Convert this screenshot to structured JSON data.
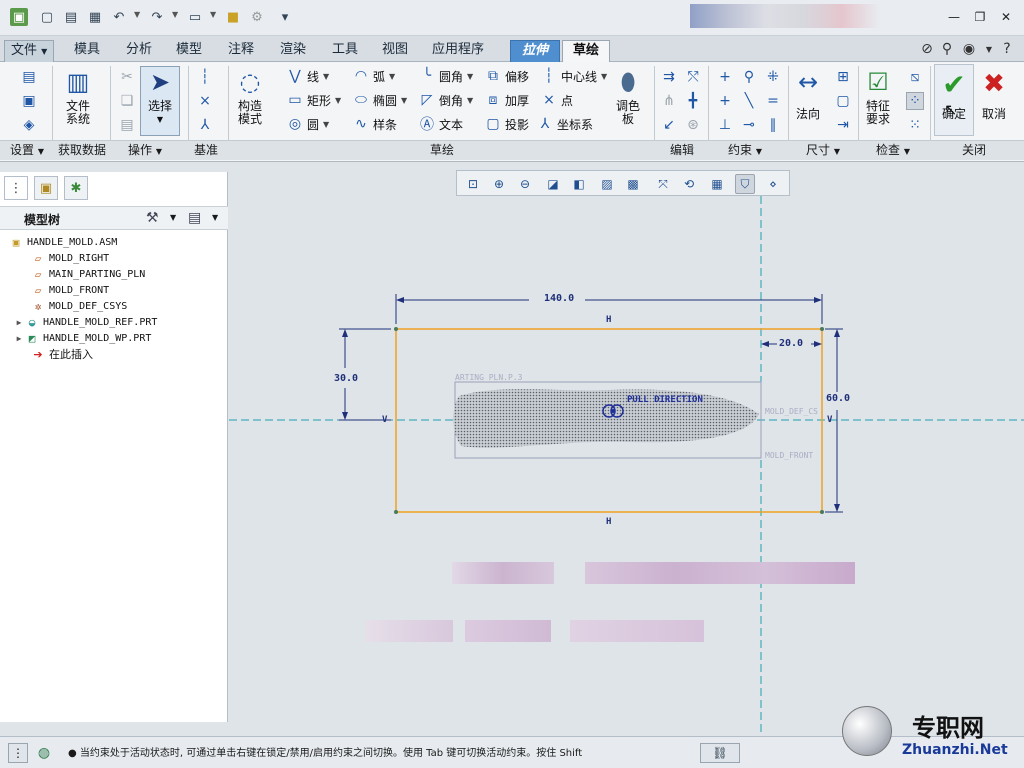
{
  "colors": {
    "ribbon_bg": "#f3f5f7",
    "canvas_bg": "#dfe4e8",
    "sketch_rect": "#f0a020",
    "dimension": "#1f2f7a",
    "centerline": "#1fa0b0",
    "confirm_green": "#2a9a2a",
    "cancel_red": "#cc2222",
    "active_tab": "#4f8fcf"
  },
  "quick_access": {
    "icons": [
      "app-logo-icon",
      "new-file-icon",
      "open-file-icon",
      "save-icon",
      "undo-icon",
      "redo-icon",
      "window-icon",
      "folder-icon",
      "regenerate-icon",
      "customize-icon"
    ]
  },
  "menu_tabs": [
    {
      "label": "文件"
    },
    {
      "label": "模具"
    },
    {
      "label": "分析"
    },
    {
      "label": "模型"
    },
    {
      "label": "注释"
    },
    {
      "label": "渲染"
    },
    {
      "label": "工具"
    },
    {
      "label": "视图"
    },
    {
      "label": "应用程序"
    },
    {
      "label": "拉伸"
    },
    {
      "label": "草绘"
    }
  ],
  "ribbon": {
    "groups": {
      "settings": "设置",
      "get_data": "获取数据",
      "operations": "操作",
      "datum": "基准",
      "sketch": "草绘",
      "edit": "编辑",
      "constrain": "约束",
      "dimension": "尺寸",
      "inspect": "检查",
      "close": "关闭"
    },
    "file_system": [
      "文件",
      "系统"
    ],
    "select": "选择",
    "construction_mode": [
      "构造",
      "模式"
    ],
    "sketch_tools": {
      "line": "线",
      "arc": "弧",
      "fillet": "圆角",
      "offset": "偏移",
      "centerline": "中心线",
      "rectangle": "矩形",
      "ellipse": "椭圆",
      "chamfer": "倒角",
      "thicken": "加厚",
      "point": "点",
      "circle": "圆",
      "spline": "样条",
      "text": "文本",
      "project": "投影",
      "csys": "坐标系"
    },
    "palette": [
      "调色",
      "板"
    ],
    "normal": "法向",
    "feature_req": [
      "特征",
      "要求"
    ],
    "confirm": "确定",
    "cancel": "取消"
  },
  "left_panel": {
    "title": "模型树",
    "tree": [
      {
        "label": "HANDLE_MOLD.ASM",
        "icon": "assembly-icon"
      },
      {
        "label": "MOLD_RIGHT",
        "icon": "datum-plane-icon"
      },
      {
        "label": "MAIN_PARTING_PLN",
        "icon": "datum-plane-icon"
      },
      {
        "label": "MOLD_FRONT",
        "icon": "datum-plane-icon"
      },
      {
        "label": "MOLD_DEF_CSYS",
        "icon": "csys-icon"
      },
      {
        "label": "HANDLE_MOLD_REF.PRT",
        "icon": "part-icon"
      },
      {
        "label": "HANDLE_MOLD_WP.PRT",
        "icon": "workpiece-icon"
      },
      {
        "label": "在此插入",
        "icon": "insert-here-icon"
      }
    ]
  },
  "sketch": {
    "dim_width": "140.0",
    "dim_height": "60.0",
    "dim_offset_left": "30.0",
    "dim_offset_right": "20.0",
    "h_label": "H",
    "v_label": "V",
    "pull_direction": "PULL DIRECTION"
  },
  "status_bar": {
    "message": "● 当约束处于活动状态时, 可通过单击右键在锁定/禁用/启用约束之间切换。使用 Tab 键可切换活动约束。按住 Shift"
  },
  "watermark": {
    "cn": "专职网",
    "url": "Zhuanzhi.Net"
  }
}
